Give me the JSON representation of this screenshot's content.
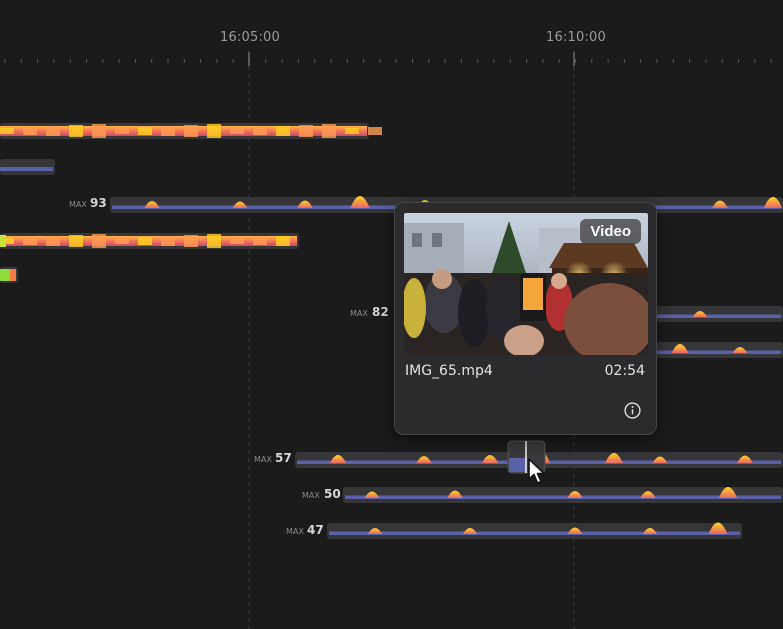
{
  "timeline": {
    "time_labels": [
      "16:05:00",
      "16:10:00"
    ],
    "max_prefix": "MAX",
    "tracks": [
      {
        "kind": "dense",
        "max": ""
      },
      {
        "kind": "short",
        "max": ""
      },
      {
        "kind": "sparse",
        "max": "93"
      },
      {
        "kind": "dense",
        "max": ""
      },
      {
        "kind": "stub",
        "max": ""
      },
      {
        "kind": "sparse",
        "max": "82"
      },
      {
        "kind": "sparse",
        "max": ""
      },
      {
        "kind": "sparse",
        "max": "57"
      },
      {
        "kind": "sparse",
        "max": "50"
      },
      {
        "kind": "sparse",
        "max": "47"
      }
    ]
  },
  "popup": {
    "badge": "Video",
    "filename": "IMG_65.mp4",
    "duration": "02:54",
    "info_icon": "info-icon"
  },
  "colors": {
    "background": "#1b1b1c",
    "track_bg": "#363638",
    "track_base": "#5b61a8",
    "peak_low": "#e8666a",
    "peak_high": "#ffd21e"
  }
}
